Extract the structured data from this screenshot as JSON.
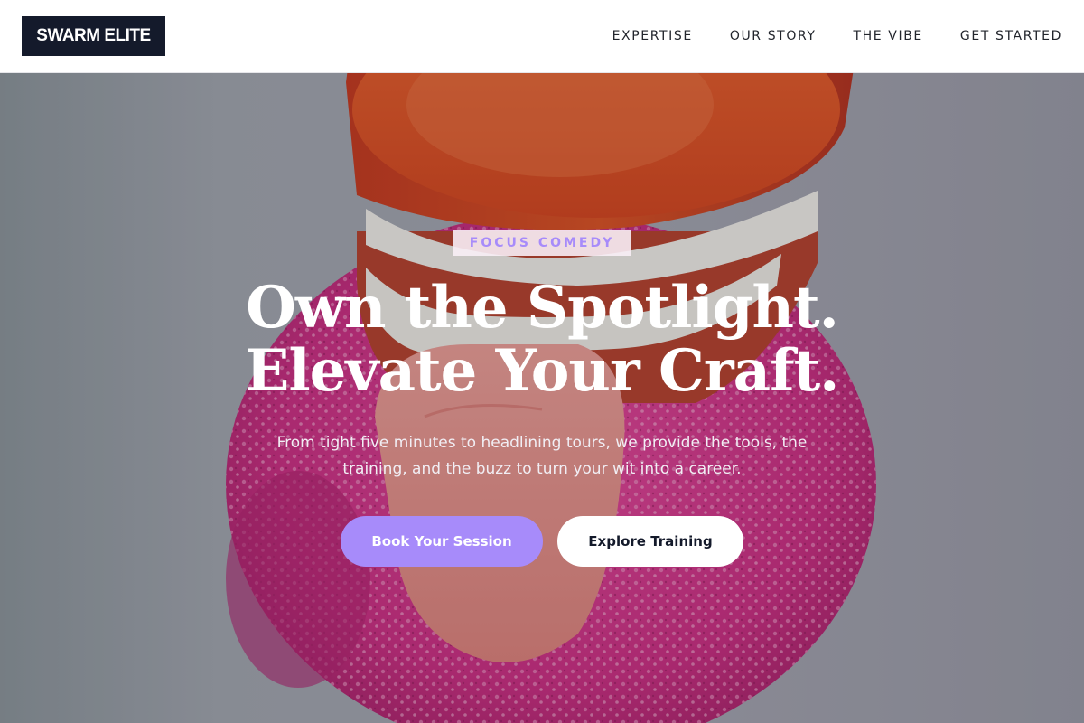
{
  "brand": {
    "name": "SWARM ELITE"
  },
  "nav": {
    "items": [
      {
        "label": "EXPERTISE"
      },
      {
        "label": "OUR STORY"
      },
      {
        "label": "THE VIBE"
      },
      {
        "label": "GET STARTED"
      }
    ]
  },
  "hero": {
    "eyebrow": "FOCUS COMEDY",
    "headline_line1": "Own the Spotlight.",
    "headline_line2": "Elevate Your Craft.",
    "subtitle": "From tight five minutes to headlining tours, we provide the tools, the training, and the buzz to turn your wit into a career.",
    "primary_cta": "Book Your Session",
    "secondary_cta": "Explore Training",
    "image_subject": "wind-up chattering teeth toy with tongue out on pink textured base"
  },
  "colors": {
    "accent": "#a78bfa",
    "logo_bg": "#141a2b",
    "header_bg": "#ffffff",
    "pink_base": "#d12f86",
    "orange_gum": "#e8521f"
  }
}
